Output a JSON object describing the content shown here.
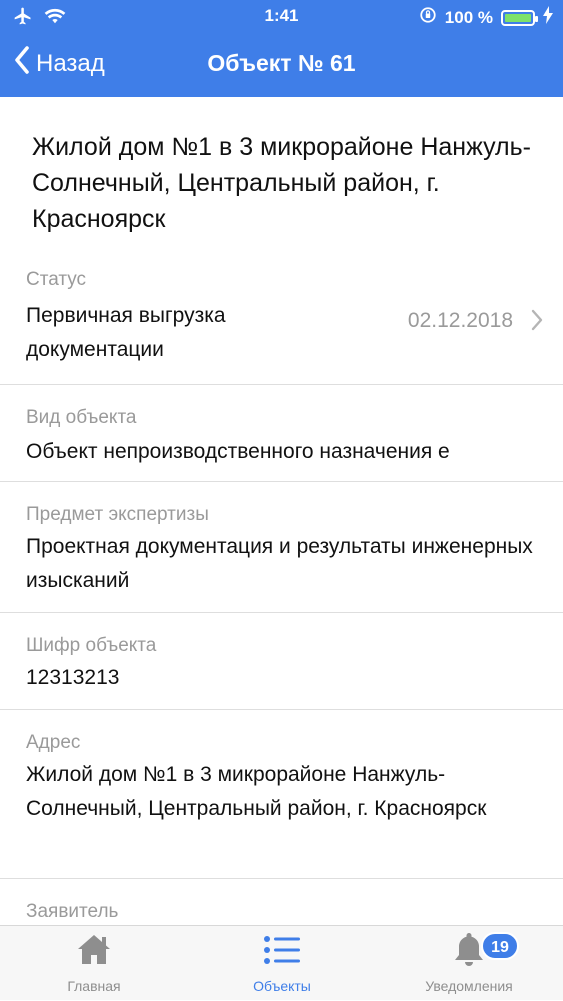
{
  "status_bar": {
    "time": "1:41",
    "battery_percent": "100 %"
  },
  "nav": {
    "back_label": "Назад",
    "title": "Объект № 61"
  },
  "object": {
    "heading": "Жилой дом №1 в 3 микрорайоне Нанжуль-Солнечный, Центральный район, г. Красноярск",
    "status": {
      "label": "Статус",
      "value": "Первичная выгрузка документации",
      "date": "02.12.2018"
    },
    "kind": {
      "label": "Вид объекта",
      "value": "Объект непроизводственного назначения е"
    },
    "subject": {
      "label": "Предмет экспертизы",
      "value": "Проектная документация и результаты инженерных изысканий"
    },
    "code": {
      "label": "Шифр объекта",
      "value": "12313213"
    },
    "address": {
      "label": "Адрес",
      "value": "Жилой дом №1 в 3 микрорайоне Нанжуль-Солнечный, Центральный район, г. Красноярск"
    },
    "applicant": {
      "label": "Заявитель"
    }
  },
  "tabs": [
    {
      "label": "Главная",
      "icon": "home-icon"
    },
    {
      "label": "Объекты",
      "icon": "list-icon",
      "active": true
    },
    {
      "label": "Уведомления",
      "icon": "bell-icon",
      "badge": "19"
    }
  ],
  "colors": {
    "accent": "#3f7ee8",
    "muted": "#9a9a9a",
    "battery": "#7ee26a"
  }
}
